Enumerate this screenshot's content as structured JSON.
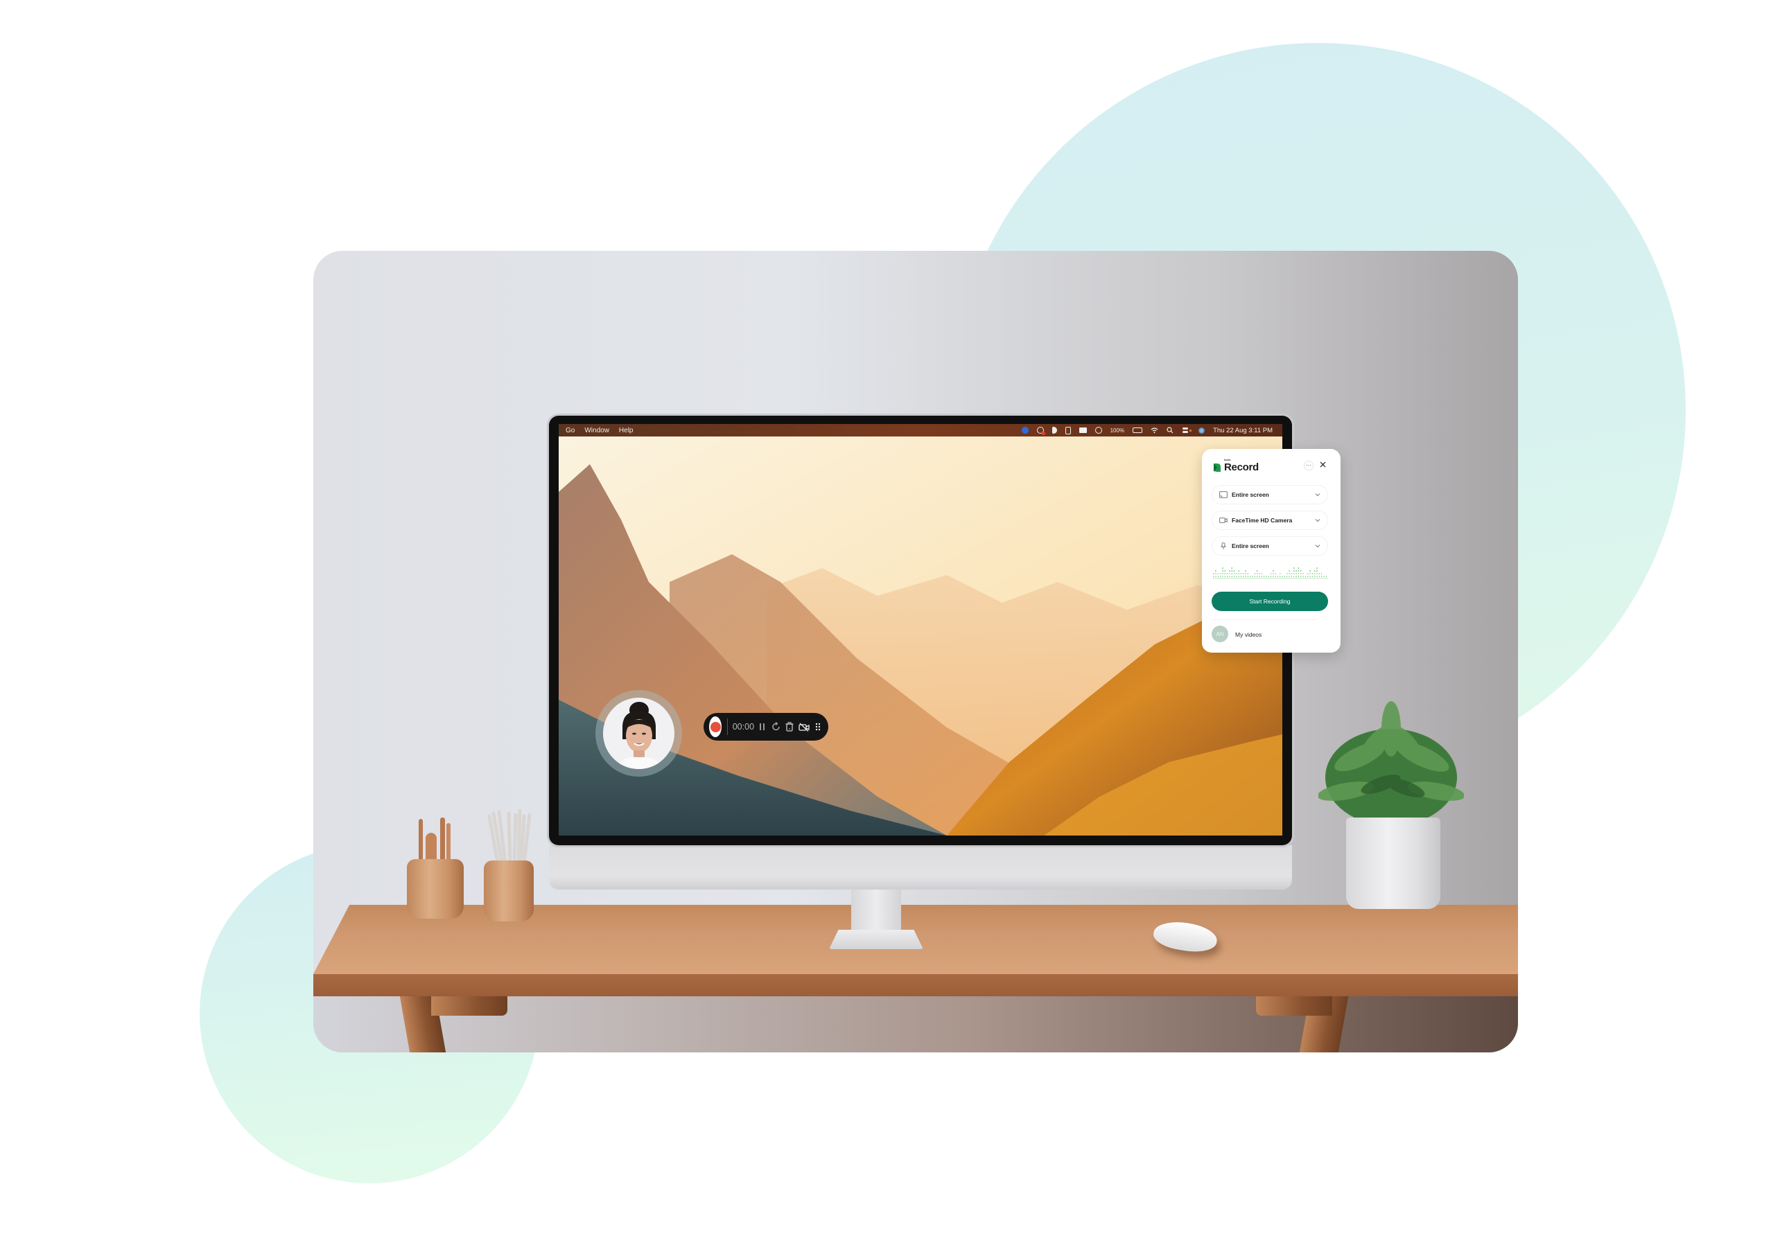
{
  "menubar": {
    "left_items": [
      "Go",
      "Window",
      "Help"
    ],
    "battery": "100%",
    "clock": "Thu 22 Aug  3:11 PM",
    "status_icons": [
      "zoom-icon",
      "creative-cloud-icon",
      "loom-icon",
      "figma-icon",
      "airplay-icon",
      "play-icon",
      "battery-icon",
      "wifi-icon",
      "search-icon",
      "control-center-icon",
      "siri-icon"
    ]
  },
  "recorder_bar": {
    "timer": "00:00",
    "buttons": [
      "record",
      "pause",
      "restart",
      "delete",
      "camera-off",
      "more"
    ]
  },
  "loom_panel": {
    "brand": "loom",
    "title": "Record",
    "screen_source": "Entire screen",
    "camera_source": "FaceTime HD Camera",
    "mic_source": "Entire screen",
    "start_button": "Start Recording",
    "avatar_initials": "AN",
    "my_videos": "My videos",
    "accent_color": "#0a7d64",
    "audio_levels": [
      1,
      2,
      1,
      1,
      3,
      2,
      1,
      2,
      3,
      2,
      1,
      2,
      1,
      1,
      2,
      1,
      0,
      0,
      1,
      2,
      1,
      1,
      0,
      0,
      0,
      1,
      2,
      1,
      0,
      1,
      0,
      0,
      1,
      2,
      1,
      3,
      2,
      3,
      2,
      1,
      0,
      1,
      2,
      1,
      2,
      3,
      1,
      1,
      0,
      0
    ]
  }
}
